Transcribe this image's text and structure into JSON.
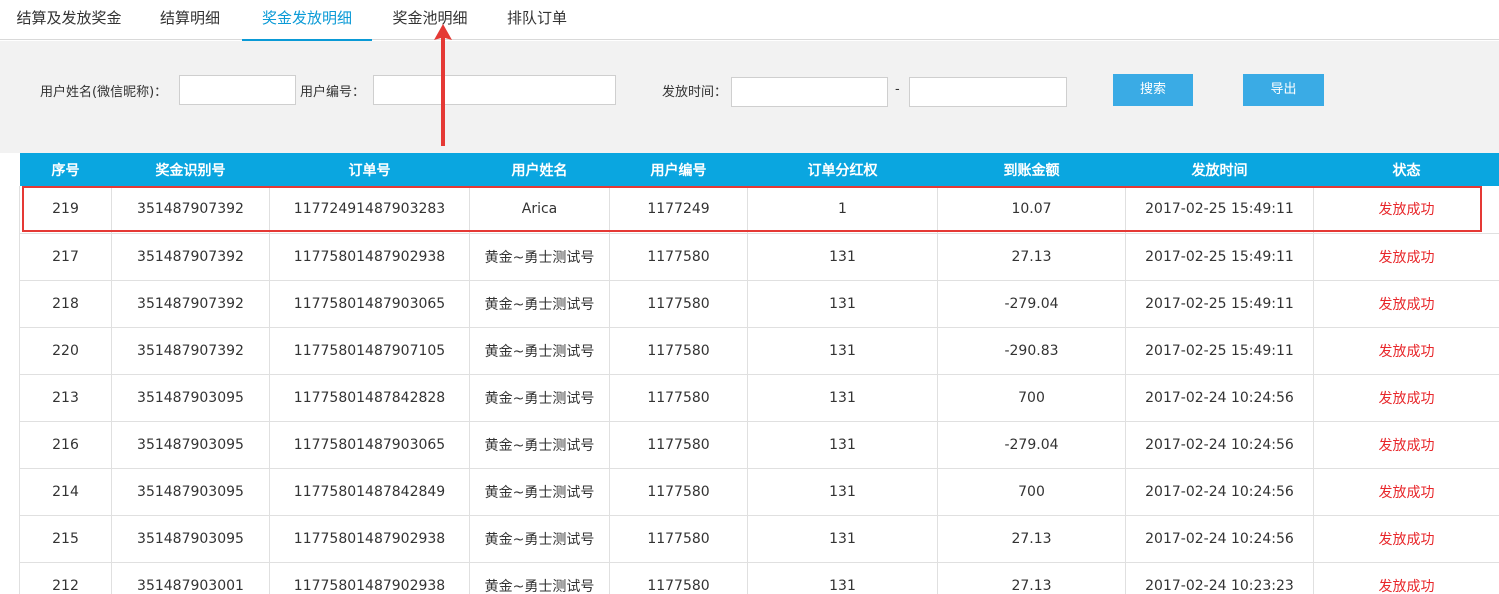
{
  "tabs": [
    {
      "label": "结算及发放奖金"
    },
    {
      "label": "结算明细"
    },
    {
      "label": "奖金发放明细"
    },
    {
      "label": "奖金池明细"
    },
    {
      "label": "排队订单"
    }
  ],
  "active_tab": "奖金发放明细",
  "filters": {
    "user_name_label": "用户姓名(微信昵称)：",
    "user_name_value": "",
    "user_id_label": "用户编号：",
    "user_id_value": "",
    "time_label": "发放时间：",
    "time_start": "",
    "time_sep": "-",
    "time_end": "",
    "search_label": "搜索",
    "export_label": "导出"
  },
  "colors": {
    "accent": "#0aa6e0",
    "button": "#3aabe5",
    "status_success": "#e8272b",
    "annotation": "#e53935"
  },
  "table": {
    "columns": [
      "序号",
      "奖金识别号",
      "订单号",
      "用户姓名",
      "用户编号",
      "订单分红权",
      "到账金额",
      "发放时间",
      "状态"
    ],
    "rows": [
      [
        "219",
        "351487907392",
        "11772491487903283",
        "Arica",
        "1177249",
        "1",
        "10.07",
        "2017-02-25 15:49:11",
        "发放成功"
      ],
      [
        "217",
        "351487907392",
        "11775801487902938",
        "黄金~勇士测试号",
        "1177580",
        "131",
        "27.13",
        "2017-02-25 15:49:11",
        "发放成功"
      ],
      [
        "218",
        "351487907392",
        "11775801487903065",
        "黄金~勇士测试号",
        "1177580",
        "131",
        "-279.04",
        "2017-02-25 15:49:11",
        "发放成功"
      ],
      [
        "220",
        "351487907392",
        "11775801487907105",
        "黄金~勇士测试号",
        "1177580",
        "131",
        "-290.83",
        "2017-02-25 15:49:11",
        "发放成功"
      ],
      [
        "213",
        "351487903095",
        "11775801487842828",
        "黄金~勇士测试号",
        "1177580",
        "131",
        "700",
        "2017-02-24 10:24:56",
        "发放成功"
      ],
      [
        "216",
        "351487903095",
        "11775801487903065",
        "黄金~勇士测试号",
        "1177580",
        "131",
        "-279.04",
        "2017-02-24 10:24:56",
        "发放成功"
      ],
      [
        "214",
        "351487903095",
        "11775801487842849",
        "黄金~勇士测试号",
        "1177580",
        "131",
        "700",
        "2017-02-24 10:24:56",
        "发放成功"
      ],
      [
        "215",
        "351487903095",
        "11775801487902938",
        "黄金~勇士测试号",
        "1177580",
        "131",
        "27.13",
        "2017-02-24 10:24:56",
        "发放成功"
      ],
      [
        "212",
        "351487903001",
        "11775801487902938",
        "黄金~勇士测试号",
        "1177580",
        "131",
        "27.13",
        "2017-02-24 10:23:23",
        "发放成功"
      ]
    ]
  },
  "annotations": {
    "arrow_icon": "red-up-arrow-icon",
    "highlight": "red-box-highlight"
  }
}
